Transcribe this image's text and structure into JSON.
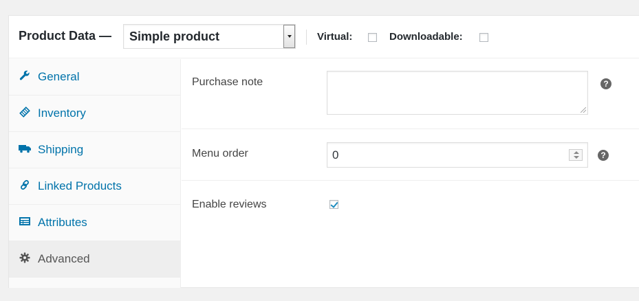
{
  "header": {
    "title": "Product Data —",
    "product_type": {
      "selected": "Simple product"
    },
    "virtual_label": "Virtual:",
    "virtual_checked": false,
    "downloadable_label": "Downloadable:",
    "downloadable_checked": false
  },
  "sidebar": {
    "items": [
      {
        "label": "General",
        "icon": "wrench-icon",
        "active": false
      },
      {
        "label": "Inventory",
        "icon": "tag-icon",
        "active": false
      },
      {
        "label": "Shipping",
        "icon": "truck-icon",
        "active": false
      },
      {
        "label": "Linked Products",
        "icon": "link-icon",
        "active": false
      },
      {
        "label": "Attributes",
        "icon": "list-icon",
        "active": false
      },
      {
        "label": "Advanced",
        "icon": "gear-icon",
        "active": true
      }
    ]
  },
  "advanced": {
    "purchase_note": {
      "label": "Purchase note",
      "value": ""
    },
    "menu_order": {
      "label": "Menu order",
      "value": "0"
    },
    "enable_reviews": {
      "label": "Enable reviews",
      "checked": true
    },
    "help_glyph": "?"
  },
  "colors": {
    "link": "#0073aa",
    "active_tab_bg": "#eeeeee",
    "checkmark": "#1e8cbe"
  }
}
